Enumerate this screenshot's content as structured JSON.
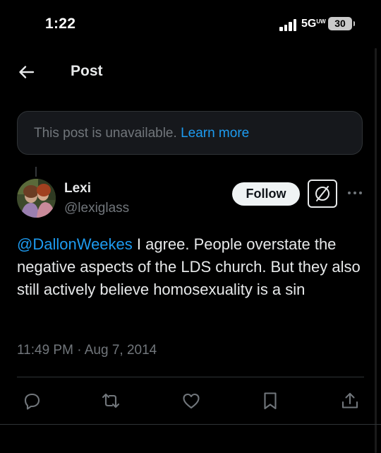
{
  "status_bar": {
    "time": "1:22",
    "network": "5G",
    "network_suffix": "UW",
    "battery": "30"
  },
  "header": {
    "title": "Post",
    "back_icon": "arrow-left-icon"
  },
  "notice": {
    "text": "This post is unavailable.",
    "link": "Learn more"
  },
  "tweet": {
    "author": {
      "name": "Lexi",
      "handle": "@lexiglass"
    },
    "follow_label": "Follow",
    "mention": "@DallonWeekes",
    "body": " I agree. People overstate the negative aspects of the LDS church. But they also still actively believe homosexuality is a sin",
    "timestamp": "11:49 PM · Aug 7, 2014"
  },
  "actions": [
    {
      "name": "reply",
      "icon": "reply-icon"
    },
    {
      "name": "repost",
      "icon": "repost-icon"
    },
    {
      "name": "like",
      "icon": "heart-icon"
    },
    {
      "name": "bookmark",
      "icon": "bookmark-icon"
    },
    {
      "name": "share",
      "icon": "share-icon"
    }
  ],
  "colors": {
    "background": "#000000",
    "accent": "#1d9bf0",
    "secondary_text": "#71767b",
    "primary_text": "#e7e9ea",
    "border": "#2f3336"
  }
}
